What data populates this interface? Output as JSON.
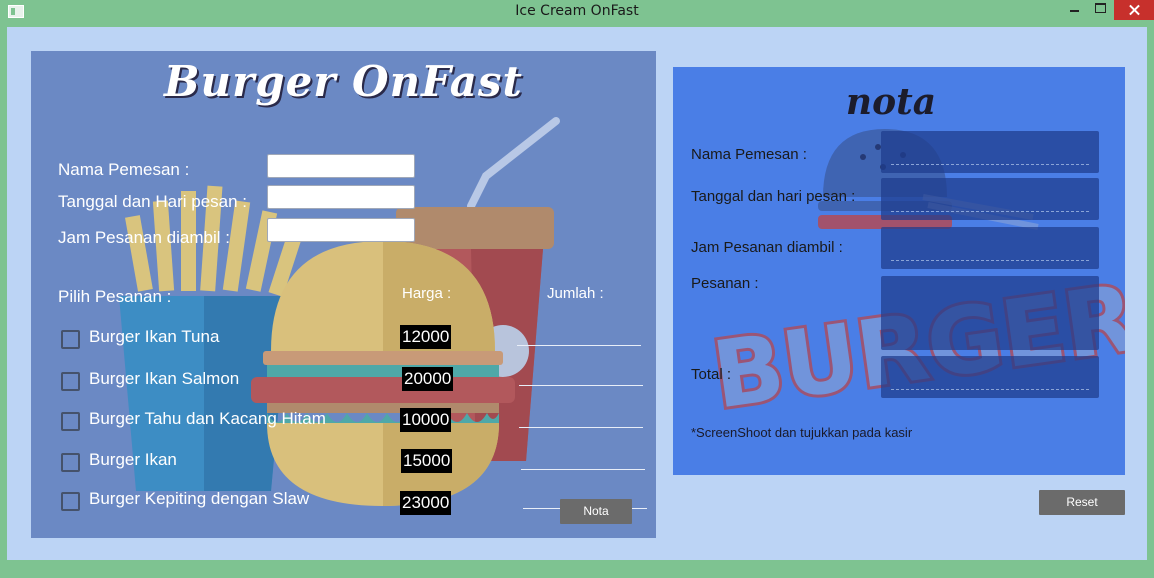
{
  "window": {
    "title": "Ice Cream OnFast"
  },
  "left": {
    "brand": "Burger OnFast",
    "fields": [
      {
        "label": "Nama Pemesan :",
        "value": ""
      },
      {
        "label": "Tanggal dan Hari pesan :",
        "value": ""
      },
      {
        "label": "Jam Pesanan diambil :",
        "value": ""
      }
    ],
    "pilih_label": "Pilih Pesanan :",
    "harga_label": "Harga :",
    "jumlah_label": "Jumlah :",
    "menu": [
      {
        "name": "Burger Ikan Tuna",
        "price": "12000",
        "checked": false
      },
      {
        "name": "Burger Ikan Salmon",
        "price": "20000",
        "checked": false
      },
      {
        "name": "Burger Tahu dan Kacang Hitam",
        "price": "10000",
        "checked": false
      },
      {
        "name": "Burger Ikan",
        "price": "15000",
        "checked": false
      },
      {
        "name": "Burger Kepiting dengan Slaw",
        "price": "23000",
        "checked": false
      }
    ],
    "nota_button": "Nota"
  },
  "right": {
    "title": "nota",
    "watermark": "BURGER",
    "labels": {
      "nama": "Nama Pemesan :",
      "tanggal": "Tanggal dan hari pesan :",
      "jam": "Jam Pesanan diambil :",
      "pesanan": "Pesanan :",
      "total": "Total :"
    },
    "values": {
      "nama": "",
      "tanggal": "",
      "jam": "",
      "pesanan": "",
      "total": ""
    },
    "note": "*ScreenShoot dan tujukkan pada kasir"
  },
  "reset_button": "Reset",
  "colors": {
    "titlebar": "#7ec391",
    "client_bg": "#bcd4f5",
    "left_panel": "#6b89c4",
    "right_panel": "#4a7ee6",
    "close_button": "#c7302c",
    "button_gray": "#6b6b6b"
  }
}
